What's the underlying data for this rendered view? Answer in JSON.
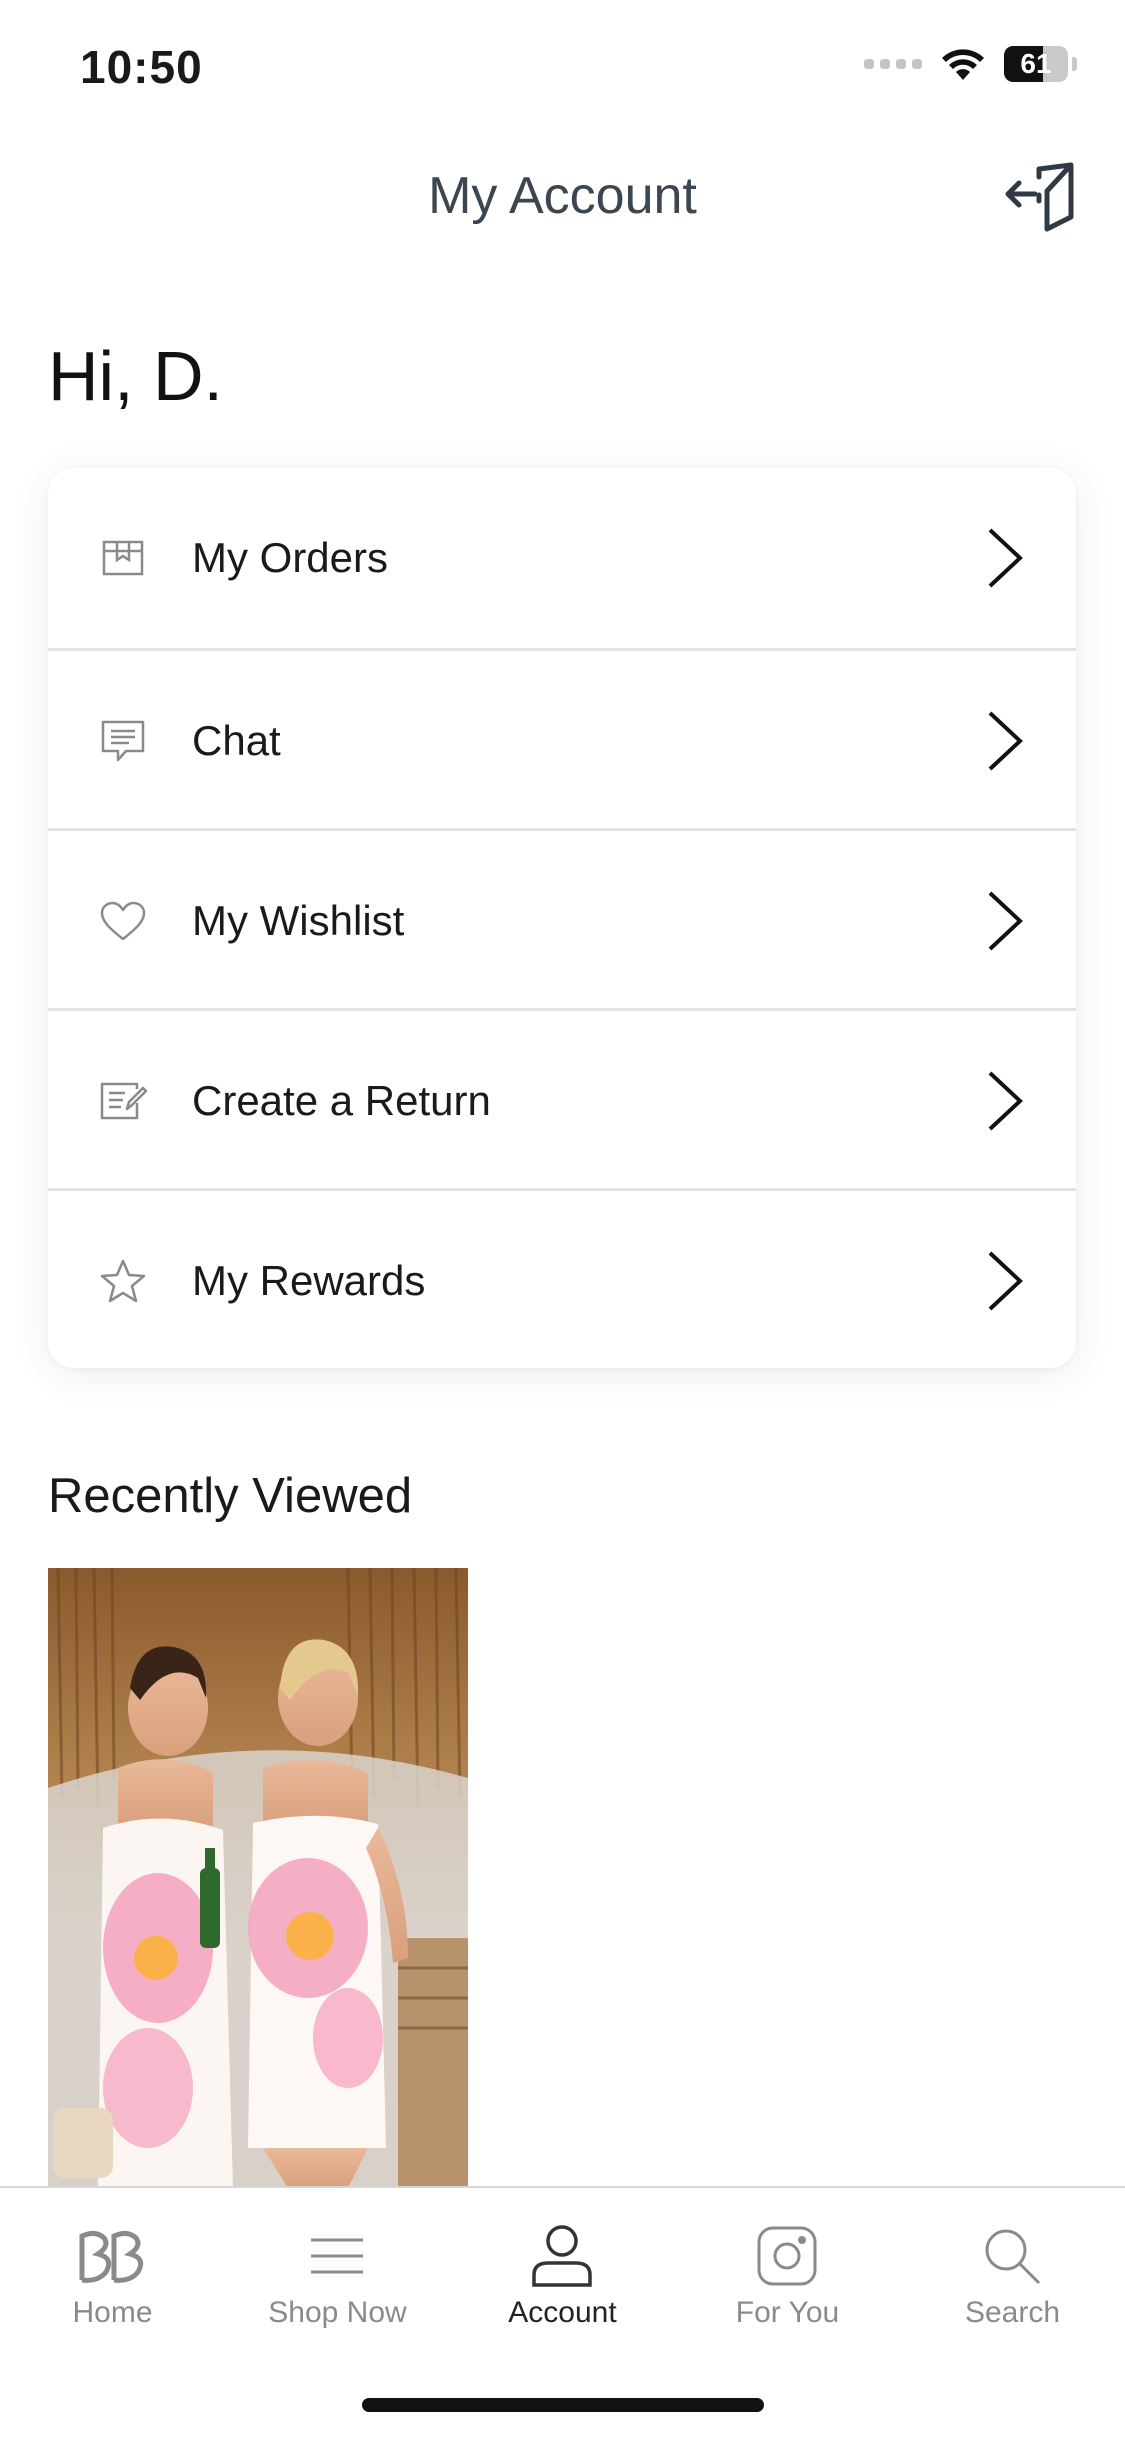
{
  "status_bar": {
    "time": "10:50",
    "battery": "61"
  },
  "header": {
    "title": "My Account"
  },
  "greeting": "Hi,  D.",
  "menu": [
    {
      "label": "My Orders",
      "icon": "box-icon"
    },
    {
      "label": "Chat",
      "icon": "chat-icon"
    },
    {
      "label": "My Wishlist",
      "icon": "heart-icon"
    },
    {
      "label": "Create a Return",
      "icon": "return-form-icon"
    },
    {
      "label": "My Rewards",
      "icon": "star-icon"
    }
  ],
  "recently_viewed": {
    "title": "Recently Viewed"
  },
  "tabs": [
    {
      "label": "Home",
      "icon": "brand-logo-icon"
    },
    {
      "label": "Shop Now",
      "icon": "menu-lines-icon"
    },
    {
      "label": "Account",
      "icon": "person-icon",
      "active": true
    },
    {
      "label": "For You",
      "icon": "instagram-icon"
    },
    {
      "label": "Search",
      "icon": "search-icon"
    }
  ]
}
